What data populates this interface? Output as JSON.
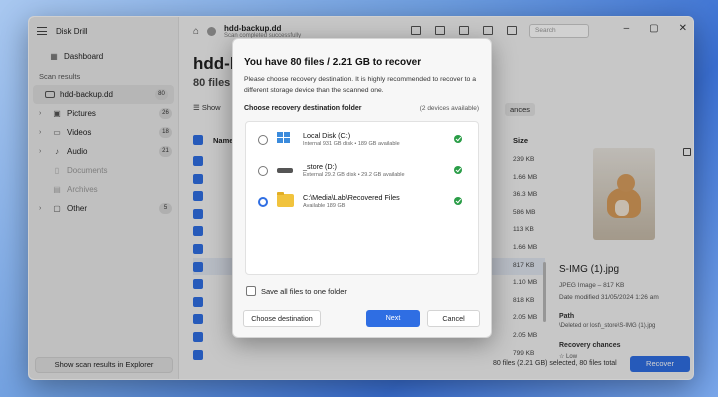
{
  "app": {
    "title": "Disk Drill",
    "current_source": "hdd-backup.dd",
    "scan_status": "Scan completed successfully",
    "big_title": "hdd-b",
    "sub_title": "80 files ,",
    "show_label": "Show",
    "chip_label": "ances",
    "search_placeholder": "Search"
  },
  "sidebar": {
    "dashboard": "Dashboard",
    "section": "Scan results",
    "items": [
      {
        "label": "hdd-backup.dd",
        "count": "80",
        "icon": "drive-icon",
        "chevron": ""
      },
      {
        "label": "Pictures",
        "count": "26",
        "icon": "pictures-icon",
        "chevron": "›"
      },
      {
        "label": "Videos",
        "count": "18",
        "icon": "videos-icon",
        "chevron": "›"
      },
      {
        "label": "Audio",
        "count": "21",
        "icon": "audio-icon",
        "chevron": "›"
      },
      {
        "label": "Documents",
        "count": "",
        "icon": "documents-icon",
        "chevron": ""
      },
      {
        "label": "Archives",
        "count": "",
        "icon": "archives-icon",
        "chevron": ""
      },
      {
        "label": "Other",
        "count": "5",
        "icon": "other-icon",
        "chevron": "›"
      }
    ],
    "bottom_button": "Show scan results in Explorer"
  },
  "table": {
    "col_name": "Name",
    "col_size": "Size",
    "sizes": [
      "239 KB",
      "1.66 MB",
      "36.3 MB",
      "586 MB",
      "113 KB",
      "1.66 MB",
      "817 KB",
      "1.10 MB",
      "818 KB",
      "2.05 MB",
      "2.05 MB",
      "799 KB"
    ]
  },
  "preview": {
    "file_name": "S-IMG (1).jpg",
    "file_type": "JPEG Image – 817 KB",
    "date_modified": "Date modified 31/05/2024 1:26 am",
    "path_label": "Path",
    "path_value": "\\Deleted or lost\\_store\\S-IMG (1).jpg",
    "chances_label": "Recovery chances",
    "chances_value": "Low"
  },
  "status": {
    "text": "80 files (2.21 GB) selected, 80 files total",
    "recover_label": "Recover"
  },
  "dialog": {
    "title": "You have 80 files / 2.21 GB to recover",
    "description": "Please choose recovery destination. It is highly recommended to recover to a different storage device than the scanned one.",
    "subheading": "Choose recovery destination folder",
    "devices_available": "(2 devices available)",
    "destinations": [
      {
        "name": "Local Disk (C:)",
        "info": "Internal 931 GB disk • 189 GB available",
        "selected": false
      },
      {
        "name": "_store (D:)",
        "info": "External 29.2 GB disk • 29.2 GB available",
        "selected": false
      },
      {
        "name": "C:\\Media\\Lab\\Recovered Files",
        "info": "Available 189 GB",
        "selected": true
      }
    ],
    "save_all_label": "Save all files to one folder",
    "choose_label": "Choose destination",
    "next_label": "Next",
    "cancel_label": "Cancel"
  },
  "colors": {
    "accent": "#2f6ee3",
    "ok": "#2a9d47",
    "folder": "#f1c33d"
  }
}
